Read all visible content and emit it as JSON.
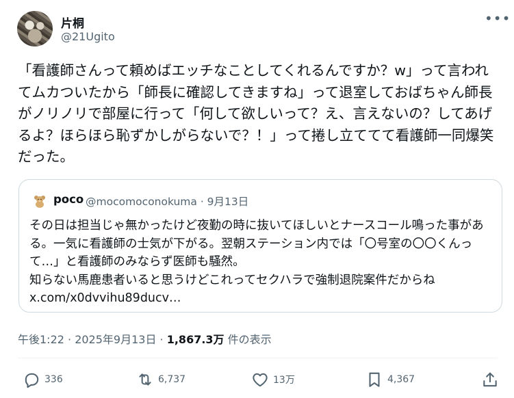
{
  "post": {
    "author": {
      "display_name": "片桐",
      "handle": "@21Ugito"
    },
    "more_icon": "•••",
    "text": "「看護師さんって頼めばエッチなことしてくれるんですか？w」って言われてムカついたから「師長に確認してきますね」って退室しておばちゃん師長がノリノリで部屋に行って「何して欲しいって？え、言えないの？してあげるよ？ほらほら恥ずかしがらないで？！」って捲し立ててて看護師一同爆笑だった。",
    "quote": {
      "avatar_icon": "teddy-bear-icon",
      "display_name": "poco",
      "meta": "@mocomoconokuma · 9月13日",
      "text": "その日は担当じゃ無かったけど夜勤の時に抜いてほしいとナースコール鳴った事がある。一気に看護師の士気が下がる。翌朝ステーション内では「〇号室の〇〇くんって…」と看護師のみならず医師も騒然。\n知らない馬鹿患者いると思うけどこれってセクハラで強制退院案件だからね\nx.com/x0dvvihu89ducv…"
    },
    "timestamp": {
      "time": "午後1:22 · 2025年9月13日 · ",
      "views": "1,867.3万",
      "views_label": " 件の表示"
    },
    "actions": {
      "replies": "336",
      "reposts": "6,737",
      "likes": "13万",
      "bookmarks": "4,367"
    }
  }
}
